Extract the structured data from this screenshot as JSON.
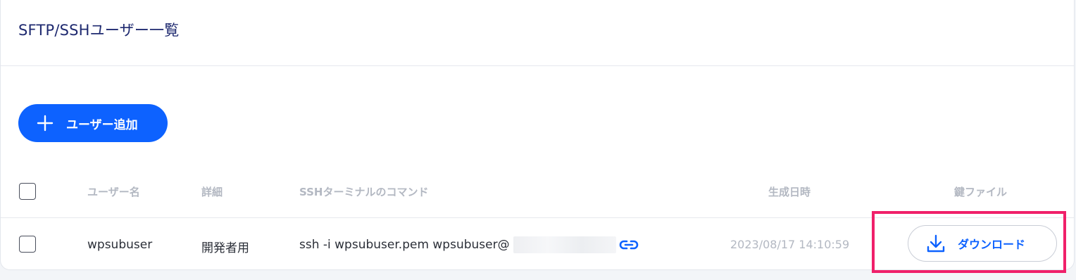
{
  "page": {
    "title": "SFTP/SSHユーザー一覧"
  },
  "toolbar": {
    "add_user_label": "ユーザー追加",
    "add_icon": "plus-icon"
  },
  "table": {
    "headers": {
      "username": "ユーザー名",
      "details": "詳細",
      "ssh_command": "SSHターミナルのコマンド",
      "created": "生成日時",
      "key_file": "鍵ファイル"
    },
    "rows": [
      {
        "username": "wpsubuser",
        "details": "開発者用",
        "ssh_command": "ssh -i wpsubuser.pem wpsubuser@",
        "created": "2023/08/17 14:10:59",
        "download_label": "ダウンロード",
        "copy_icon": "link-icon",
        "download_icon": "download-icon"
      }
    ]
  },
  "colors": {
    "primary": "#0d62ff",
    "title": "#1f2a70",
    "highlight": "#f0206a",
    "muted": "#b3b8c2"
  }
}
